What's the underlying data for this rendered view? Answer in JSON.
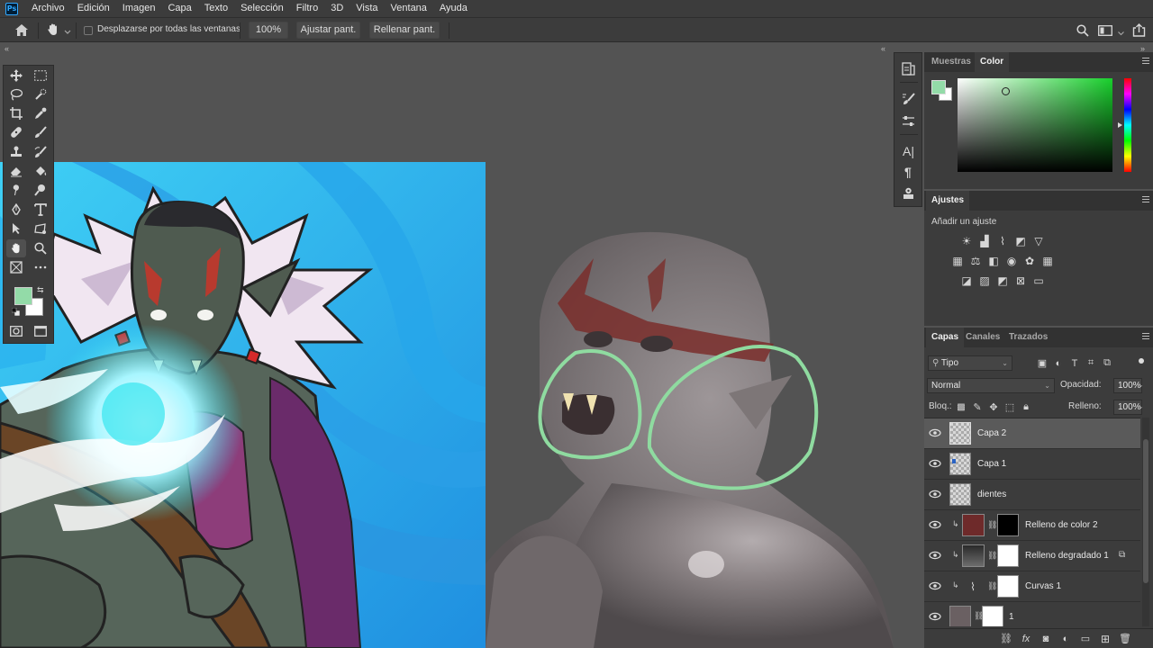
{
  "app": {
    "logo_text": "Ps"
  },
  "menu": [
    "Archivo",
    "Edición",
    "Imagen",
    "Capa",
    "Texto",
    "Selección",
    "Filtro",
    "3D",
    "Vista",
    "Ventana",
    "Ayuda"
  ],
  "options": {
    "scroll_all_label": "Desplazarse por todas las ventanas",
    "scroll_all_checked": false,
    "zoom_value": "100%",
    "fit_screen_label": "Ajustar pant.",
    "fill_screen_label": "Rellenar pant."
  },
  "colors": {
    "foreground": "#93dba8",
    "background": "#ffffff",
    "selection_stroke": "#8fdba0",
    "canvas_bg": "#535353",
    "panel_bg": "#3c3c3c"
  },
  "tool_icons": [
    "move-icon",
    "marquee-icon",
    "lasso-icon",
    "quick-select-icon",
    "crop-icon",
    "eyedropper-icon",
    "healing-brush-icon",
    "brush-icon",
    "clone-stamp-icon",
    "history-brush-icon",
    "eraser-icon",
    "paint-bucket-icon",
    "smudge-icon",
    "dodge-icon",
    "pen-icon",
    "type-icon",
    "path-select-icon",
    "custom-shape-icon",
    "hand-icon",
    "zoom-icon",
    "frame-icon",
    "more-tools-icon"
  ],
  "color_panel": {
    "tabs": [
      "Muestras",
      "Color"
    ],
    "active_tab": "Color"
  },
  "adjustments_panel": {
    "title": "Ajustes",
    "add_label": "Añadir un ajuste"
  },
  "layers_panel": {
    "tabs": [
      "Capas",
      "Canales",
      "Trazados"
    ],
    "active_tab": "Capas",
    "filter_kind": "Tipo",
    "blend_mode": "Normal",
    "opacity_label": "Opacidad:",
    "opacity_value": "100%",
    "lock_label": "Bloq.:",
    "fill_label": "Relleno:",
    "fill_value": "100%",
    "layers": [
      {
        "name": "Capa 2",
        "selected": true,
        "visible": true
      },
      {
        "name": "Capa 1",
        "selected": false,
        "visible": true
      },
      {
        "name": "dientes",
        "selected": false,
        "visible": true
      },
      {
        "name": "Relleno de color 2",
        "selected": false,
        "visible": true
      },
      {
        "name": "Relleno degradado 1",
        "selected": false,
        "visible": true
      },
      {
        "name": "Curvas 1",
        "selected": false,
        "visible": true
      },
      {
        "name": "1",
        "selected": false,
        "visible": true
      }
    ]
  }
}
